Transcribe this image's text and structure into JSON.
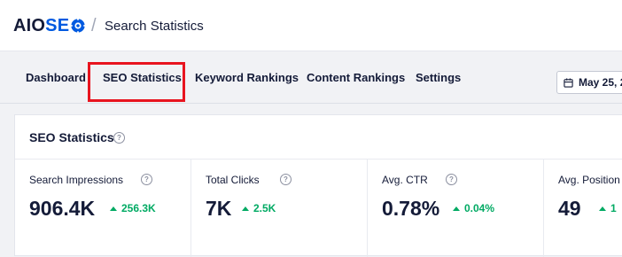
{
  "header": {
    "logo_aio": "AIO",
    "logo_seo": "SE",
    "breadcrumb_separator": "/",
    "page_title": "Search Statistics"
  },
  "tabs": [
    {
      "label": "Dashboard"
    },
    {
      "label": "SEO Statistics"
    },
    {
      "label": "Keyword Rankings"
    },
    {
      "label": "Content Rankings"
    },
    {
      "label": "Settings"
    }
  ],
  "active_tab": "SEO Statistics",
  "date_range": {
    "label": "May 25, 2"
  },
  "card": {
    "title": "SEO Statistics",
    "help": "?"
  },
  "stats": [
    {
      "label": "Search Impressions",
      "value": "906.4K",
      "delta": "256.3K"
    },
    {
      "label": "Total Clicks",
      "value": "7K",
      "delta": "2.5K"
    },
    {
      "label": "Avg. CTR",
      "value": "0.78%",
      "delta": "0.04%"
    },
    {
      "label": "Avg. Position",
      "value": "49",
      "delta": "1"
    }
  ],
  "colors": {
    "brand_blue": "#005ae0",
    "highlight_red": "#e8141f",
    "positive_green": "#00aa63",
    "text_dark": "#141b38"
  }
}
